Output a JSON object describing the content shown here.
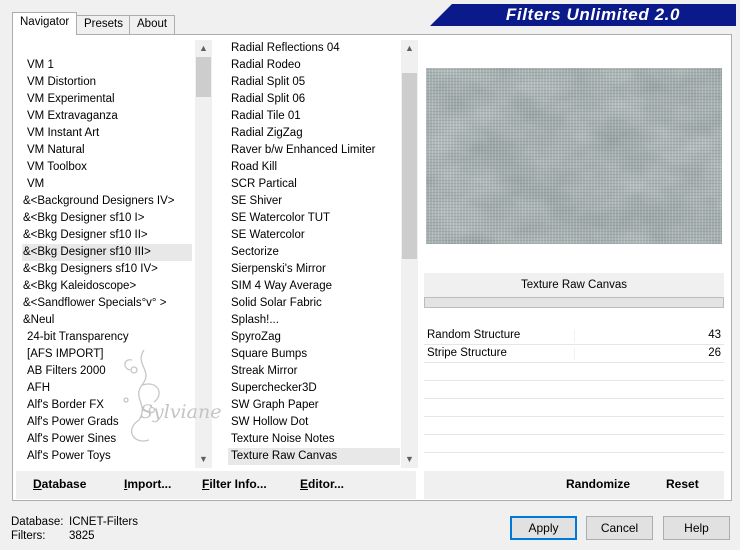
{
  "tabs": [
    {
      "label": "Navigator",
      "active": true
    },
    {
      "label": "Presets",
      "active": false
    },
    {
      "label": "About",
      "active": false
    }
  ],
  "app_title": "Filters Unlimited 2.0",
  "categories": {
    "items": [
      "VM 1",
      "VM Distortion",
      "VM Experimental",
      "VM Extravaganza",
      "VM Instant Art",
      "VM Natural",
      "VM Toolbox",
      "VM",
      "&<Background Designers IV>",
      "&<Bkg Designer sf10 I>",
      "&<Bkg Designer sf10 II>",
      "&<Bkg Designer sf10 III>",
      "&<Bkg Designers sf10 IV>",
      "&<Bkg Kaleidoscope>",
      "&<Sandflower Specials°v° >",
      "&Neul",
      "24-bit Transparency",
      "[AFS IMPORT]",
      "AB Filters 2000",
      "AFH",
      "Alf's Border FX",
      "Alf's Power Grads",
      "Alf's Power Sines",
      "Alf's Power Toys"
    ],
    "selected": "&<Bkg Designer sf10 III>",
    "scroll_position": 0.06
  },
  "filters": {
    "items": [
      "Radial Reflections 04",
      "Radial Rodeo",
      "Radial Split 05",
      "Radial Split 06",
      "Radial Tile 01",
      "Radial ZigZag",
      "Raver b/w Enhanced Limiter",
      "Road Kill",
      "SCR  Partical",
      "SE Shiver",
      "SE Watercolor TUT",
      "SE Watercolor",
      "Sectorize",
      "Sierpenski's Mirror",
      "SIM 4 Way Average",
      "Solid Solar Fabric",
      "Splash!...",
      "SpyroZag",
      "Square Bumps",
      "Streak Mirror",
      "Superchecker3D",
      "SW Graph Paper",
      "SW Hollow Dot",
      "Texture Noise Notes",
      "Texture Raw Canvas"
    ],
    "selected": "Texture Raw Canvas",
    "scroll_position": 0.55
  },
  "watermark_text": "Sylviane",
  "preview": {
    "filter_name": "Texture Raw Canvas"
  },
  "parameters": [
    {
      "label": "Random Structure",
      "value": "43"
    },
    {
      "label": "Stripe Structure",
      "value": "26"
    }
  ],
  "left_buttons": [
    {
      "mnemonic": "D",
      "rest": "atabase"
    },
    {
      "mnemonic": "I",
      "rest": "mport..."
    },
    {
      "mnemonic": "F",
      "pre": "",
      "label_before": "",
      "rest": "ilter Info..."
    },
    {
      "mnemonic": "E",
      "rest": "ditor..."
    }
  ],
  "right_buttons": {
    "randomize": "Randomize",
    "reset": "Reset"
  },
  "status": {
    "database_label": "Database:",
    "database_value": "ICNET-Filters",
    "filters_label": "Filters:",
    "filters_value": "3825"
  },
  "dialog_buttons": {
    "apply": "Apply",
    "cancel": "Cancel",
    "help": "Help"
  },
  "colors": {
    "banner": "#0b1a8a",
    "default_button_border": "#0078d7"
  }
}
